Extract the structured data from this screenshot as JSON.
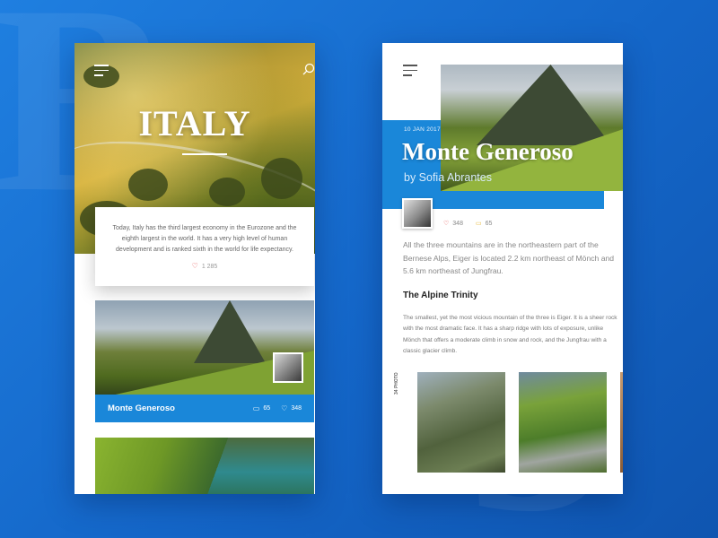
{
  "left_screen": {
    "hero": {
      "title": "ITALY"
    },
    "intro": {
      "text": "Today, Italy has the third largest economy in the Eurozone and the eighth largest in the world. It has a very high level of human development and is ranked sixth in the world for life expectancy.",
      "likes": "1 285"
    },
    "post": {
      "title": "Monte Generoso",
      "comments": "65",
      "likes": "348"
    }
  },
  "right_screen": {
    "article": {
      "date": "10 JAN 2017",
      "title": "Monte Generoso",
      "author": "by Sofia Abrantes",
      "likes": "348",
      "comments": "65",
      "lead": "All the three mountains are in the northeastern part of the Bernese Alps, Eiger is located 2.2 km northeast of Mönch and 5.6 km northeast of Jungfrau.",
      "subheading": "The Alpine Trinity",
      "body": "The smallest, yet the most vicious mountain of the three is Eiger. It is a sheer rock with the most dramatic face. It has a sharp ridge with lots of exposure, unlike Mönch that offers a moderate climb in snow and rock, and the Jungfrau with a classic glacier climb.",
      "photo_count": "34 PHOTO"
    }
  },
  "icons": {
    "menu": "menu-icon",
    "search": "search-icon",
    "heart": "heart-icon",
    "comment": "comment-icon"
  },
  "colors": {
    "accent_blue": "#1a87d9",
    "background_blue": "#1a72d4",
    "heart_red": "#e44d4d",
    "comment_yellow": "#e8b93a"
  }
}
